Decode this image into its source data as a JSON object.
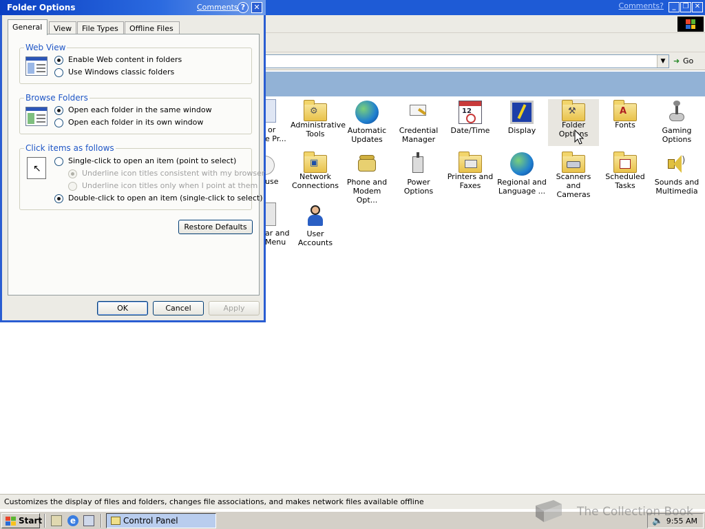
{
  "main_window": {
    "comments_link": "Comments?",
    "address_go": "Go",
    "status_text": "Customizes the display of files and folders, changes file associations, and makes network files available offline"
  },
  "control_panel": {
    "partial_labels": [
      {
        "text": "or"
      },
      {
        "text": "e Pr..."
      },
      {
        "text": "use"
      },
      {
        "text": "ar and"
      },
      {
        "text": "Menu"
      }
    ],
    "items": [
      {
        "name": "Administrative Tools",
        "icon": "administrative-tools-icon"
      },
      {
        "name": "Automatic Updates",
        "icon": "automatic-updates-icon"
      },
      {
        "name": "Credential Manager",
        "icon": "credential-manager-icon"
      },
      {
        "name": "Date/Time",
        "icon": "date-time-icon"
      },
      {
        "name": "Display",
        "icon": "display-icon"
      },
      {
        "name": "Folder Options",
        "icon": "folder-options-icon",
        "selected": true
      },
      {
        "name": "Fonts",
        "icon": "fonts-icon"
      },
      {
        "name": "Gaming Options",
        "icon": "gaming-options-icon"
      },
      {
        "name": "Network Connections",
        "icon": "network-connections-icon"
      },
      {
        "name": "Phone and Modem Opt...",
        "icon": "phone-modem-icon"
      },
      {
        "name": "Power Options",
        "icon": "power-options-icon"
      },
      {
        "name": "Printers and Faxes",
        "icon": "printers-faxes-icon"
      },
      {
        "name": "Regional and Language ...",
        "icon": "regional-language-icon"
      },
      {
        "name": "Scanners and Cameras",
        "icon": "scanners-cameras-icon"
      },
      {
        "name": "Scheduled Tasks",
        "icon": "scheduled-tasks-icon"
      },
      {
        "name": "Sounds and Multimedia",
        "icon": "sounds-multimedia-icon"
      },
      {
        "name": "User Accounts",
        "icon": "user-accounts-icon"
      }
    ]
  },
  "dialog": {
    "title": "Folder Options",
    "comments_link": "Comments?",
    "help_glyph": "?",
    "close_glyph": "✕",
    "tabs": [
      {
        "label": "General",
        "active": true
      },
      {
        "label": "View"
      },
      {
        "label": "File Types"
      },
      {
        "label": "Offline Files"
      }
    ],
    "web_view": {
      "title": "Web View",
      "options": [
        {
          "label": "Enable Web content in folders",
          "checked": true
        },
        {
          "label": "Use Windows classic folders",
          "checked": false
        }
      ]
    },
    "browse_folders": {
      "title": "Browse Folders",
      "options": [
        {
          "label": "Open each folder in the same window",
          "checked": true
        },
        {
          "label": "Open each folder in its own window",
          "checked": false
        }
      ]
    },
    "click_items": {
      "title": "Click items as follows",
      "options": [
        {
          "label": "Single-click to open an item (point to select)",
          "checked": false
        },
        {
          "label": "Underline icon titles consistent with my browser",
          "checked": true,
          "disabled": true
        },
        {
          "label": "Underline icon titles only when I point at them",
          "checked": false,
          "disabled": true
        },
        {
          "label": "Double-click to open an item (single-click to select)",
          "checked": true
        }
      ]
    },
    "restore_defaults": "Restore Defaults",
    "ok": "OK",
    "cancel": "Cancel",
    "apply": "Apply"
  },
  "taskbar": {
    "start": "Start",
    "task_label": "Control Panel",
    "clock": "9:55 AM"
  },
  "watermark": {
    "text": "The Collection Book"
  },
  "colors": {
    "titlebar_blue": "#2a5dd2",
    "group_title_blue": "#1f56c6",
    "band_blue": "#92b2d6"
  }
}
